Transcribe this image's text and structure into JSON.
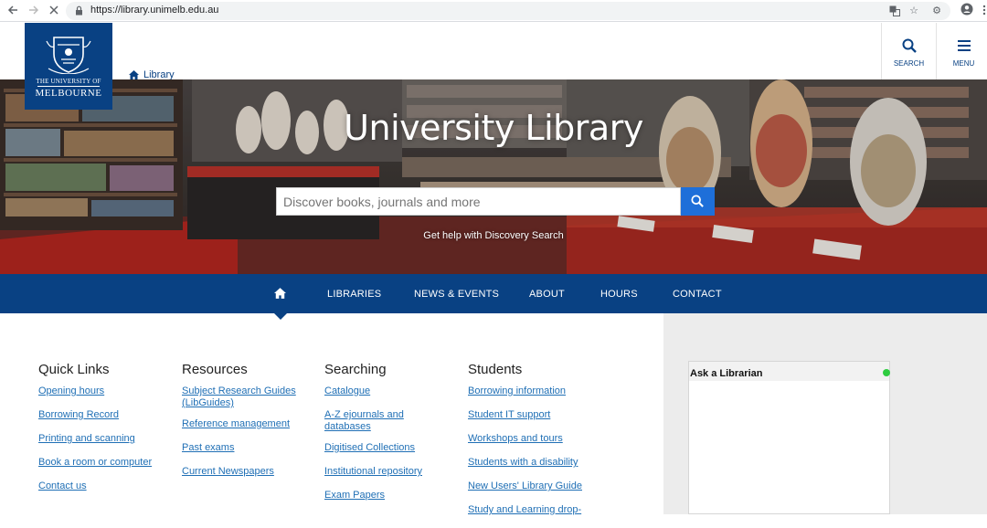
{
  "browser": {
    "url": "https://library.unimelb.edu.au",
    "icons": [
      "back-icon",
      "forward-icon",
      "stop-icon",
      "lock-icon",
      "translate-icon",
      "star-icon",
      "extension-icon",
      "account-icon",
      "more-icon"
    ]
  },
  "header": {
    "logo_line1": "THE UNIVERSITY OF",
    "logo_line2": "MELBOURNE",
    "breadcrumb": "Library",
    "search_label": "SEARCH",
    "menu_label": "MENU"
  },
  "hero": {
    "title": "University Library",
    "search_placeholder": "Discover books, journals and more",
    "help_link": "Get help with Discovery Search"
  },
  "nav": {
    "items": [
      "LIBRARIES",
      "NEWS & EVENTS",
      "ABOUT",
      "HOURS",
      "CONTACT"
    ]
  },
  "columns": [
    {
      "title": "Quick Links",
      "links": [
        "Opening hours",
        "Borrowing Record",
        "Printing and scanning",
        "Book a room or computer",
        "Contact us"
      ]
    },
    {
      "title": "Resources",
      "links": [
        "Subject Research Guides (LibGuides)",
        "Reference management",
        "Past exams",
        "Current Newspapers"
      ]
    },
    {
      "title": "Searching",
      "links": [
        "Catalogue",
        "A-Z ejournals and databases",
        "Digitised Collections",
        "Institutional repository",
        "Exam Papers"
      ]
    },
    {
      "title": "Students",
      "links": [
        "Borrowing information",
        "Student IT support",
        "Workshops and tours",
        "Students with a disability",
        "New Users' Library Guide",
        "Study and Learning drop-"
      ]
    }
  ],
  "chat": {
    "title": "Ask a Librarian",
    "status_color": "#2ecc40"
  },
  "colors": {
    "brand": "#094183",
    "link": "#1f6fb5",
    "search_button": "#1e6fd9"
  }
}
